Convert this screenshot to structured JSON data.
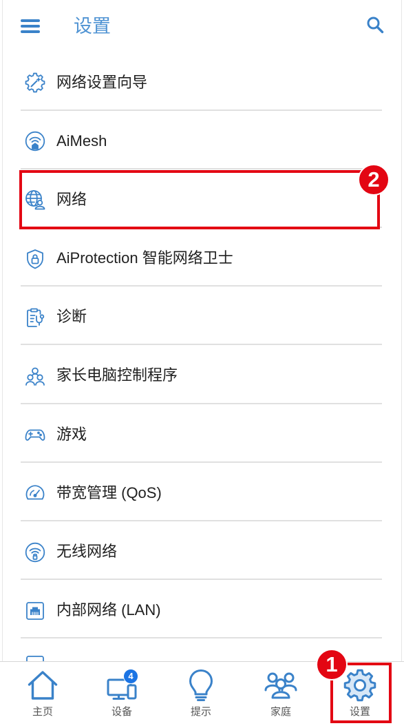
{
  "header": {
    "title": "设置",
    "menu_icon": "menu-icon",
    "search_icon": "search-icon"
  },
  "menu": {
    "items": [
      {
        "label": "网络设置向导",
        "icon": "setup-wizard-icon"
      },
      {
        "label": "AiMesh",
        "icon": "aimesh-icon"
      },
      {
        "label": "网络",
        "icon": "network-globe-icon"
      },
      {
        "label": "AiProtection 智能网络卫士",
        "icon": "shield-lock-icon"
      },
      {
        "label": "诊断",
        "icon": "diagnosis-icon"
      },
      {
        "label": "家长电脑控制程序",
        "icon": "parental-control-icon"
      },
      {
        "label": "游戏",
        "icon": "gamepad-icon"
      },
      {
        "label": "带宽管理 (QoS)",
        "icon": "speedometer-icon"
      },
      {
        "label": "无线网络",
        "icon": "wireless-icon"
      },
      {
        "label": "内部网络 (LAN)",
        "icon": "lan-port-icon"
      }
    ],
    "partial_item": {
      "icon": "list-item-icon"
    }
  },
  "annotations": {
    "network_marker": "2",
    "settings_marker": "1"
  },
  "bottom_nav": {
    "items": [
      {
        "label": "主页",
        "icon": "home-icon"
      },
      {
        "label": "设备",
        "icon": "devices-icon",
        "badge": "4"
      },
      {
        "label": "提示",
        "icon": "lightbulb-icon"
      },
      {
        "label": "家庭",
        "icon": "family-icon"
      },
      {
        "label": "设置",
        "icon": "gear-icon"
      }
    ]
  },
  "colors": {
    "accent": "#3a82c9",
    "title": "#4f93d3",
    "annotation": "#e30613",
    "badge": "#1b74e4",
    "text": "#1f1f1f",
    "nav_label": "#555555",
    "divider": "#e0e0e0"
  }
}
